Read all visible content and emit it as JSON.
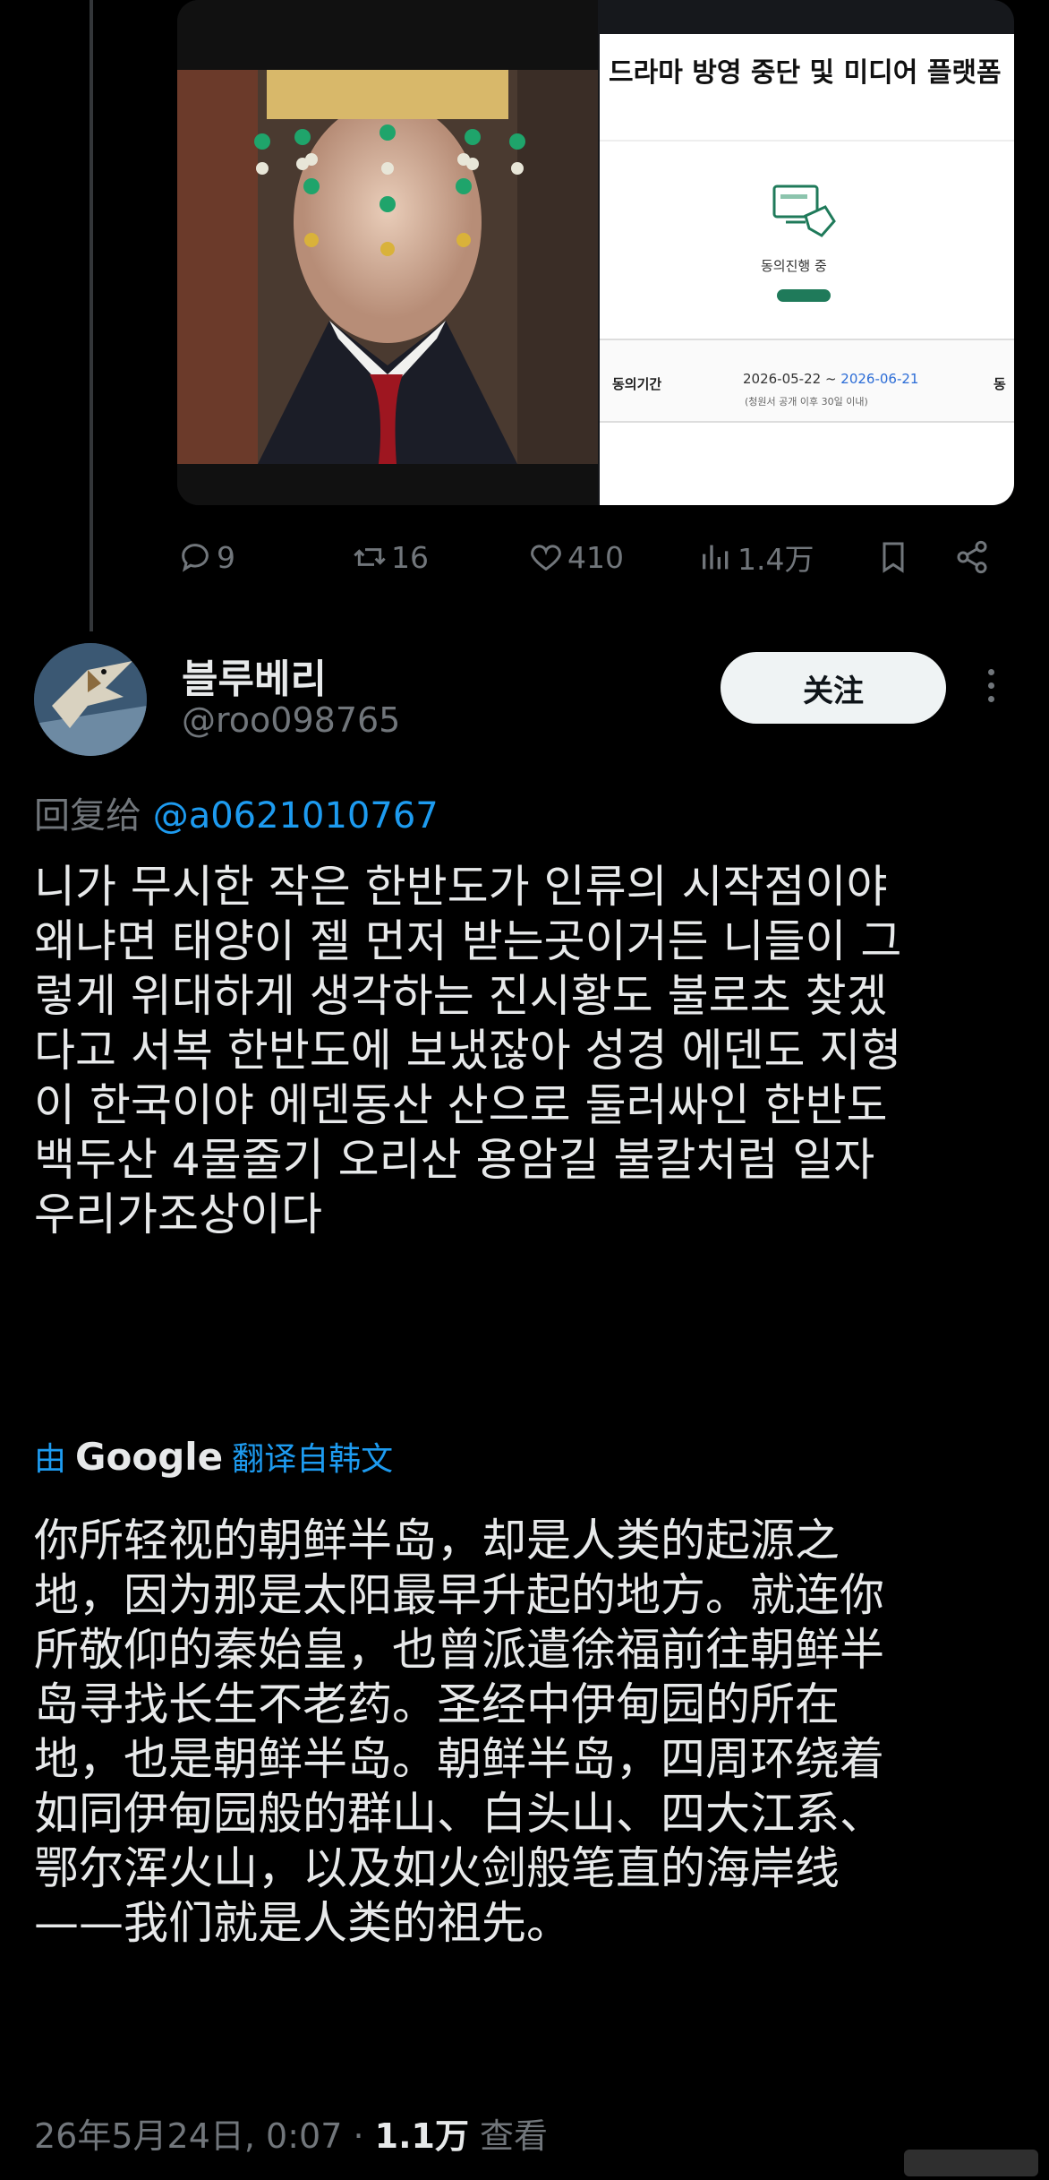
{
  "quoted_media": {
    "right_panel": {
      "title": "드라마 방영 중단 및 미디어 플랫폼",
      "status": "동의진행 중",
      "period_label": "동의기간",
      "date_start": "2026-05-22 ~ ",
      "date_end": "2026-06-21",
      "date_note": "(청원서 공개 이후 30일 이내)",
      "cut_text": "동"
    }
  },
  "actions": {
    "replies": "9",
    "reposts": "16",
    "likes": "410",
    "views": "1.4万"
  },
  "reply": {
    "author_name": "블루베리",
    "author_handle": "@roo098765",
    "follow_label": "关注",
    "reply_to_prefix": "回复给 ",
    "reply_to_handle": "@a0621010767",
    "original_lines": [
      "니가 무시한 작은 한반도가 인류의 시작점이야",
      "왜냐면 태양이 젤 먼저 받는곳이거든 니들이 그",
      "렇게 위대하게 생각하는 진시황도 불로초 찾겠",
      "다고 서복 한반도에 보냈잖아 성경 에덴도 지형",
      "이 한국이야 에덴동산 산으로 둘러싸인 한반도",
      "백두산 4물줄기 오리산 용암길 불칼처럼  일자",
      "우리가조상이다"
    ],
    "translate_by": "由",
    "translate_brand": "Google",
    "translate_suffix": "翻译自韩文",
    "translated_lines": [
      "你所轻视的朝鲜半岛，却是人类的起源之",
      "地，因为那是太阳最早升起的地方。就连你",
      "所敬仰的秦始皇，也曾派遣徐福前往朝鲜半",
      "岛寻找长生不老药。圣经中伊甸园的所在",
      "地，也是朝鲜半岛。朝鲜半岛，四周环绕着",
      "如同伊甸园般的群山、白头山、四大江系、",
      "鄂尔浑火山，以及如火剑般笔直的海岸线",
      "——我们就是人类的祖先。"
    ],
    "timestamp": "26年5月24日, 0:07 · ",
    "views": "1.1万",
    "views_suffix": " 查看"
  }
}
